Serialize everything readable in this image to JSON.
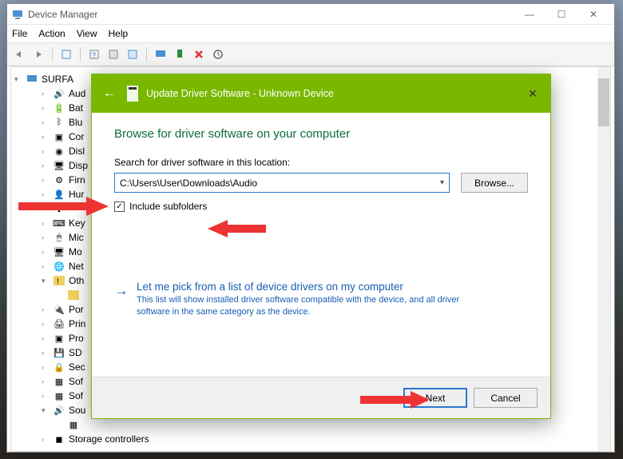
{
  "dm": {
    "title": "Device Manager",
    "menus": [
      "File",
      "Action",
      "View",
      "Help"
    ],
    "tree_root": "SURFA",
    "tree": [
      "Aud",
      "Bat",
      "Blu",
      "Cor",
      "Disl",
      "Disp",
      "Firn",
      "Hur",
      "",
      "Key",
      "Mic",
      "Mo",
      "Net",
      "Oth",
      "",
      "Por",
      "Prin",
      "Pro",
      "SD",
      "Sec",
      "Sof",
      "Sof",
      "Sou",
      "",
      "Storage controllers"
    ]
  },
  "dialog": {
    "title": "Update Driver Software - Unknown Device",
    "heading": "Browse for driver software on your computer",
    "search_label": "Search for driver software in this location:",
    "path": "C:\\Users\\User\\Downloads\\Audio",
    "browse": "Browse...",
    "include_subfolders": "Include subfolders",
    "link_title": "Let me pick from a list of device drivers on my computer",
    "link_desc": "This list will show installed driver software compatible with the device, and all driver software in the same category as the device.",
    "next": "Next",
    "cancel": "Cancel"
  }
}
